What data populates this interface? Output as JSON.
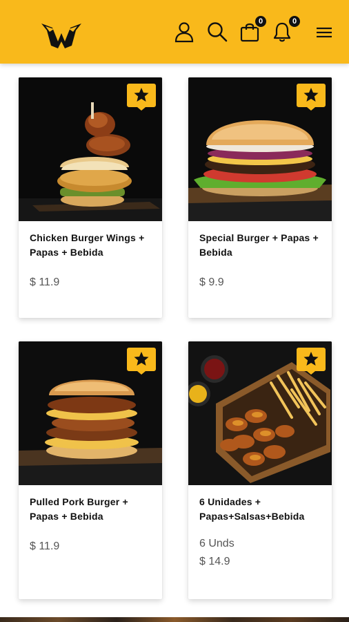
{
  "header": {
    "logo_name": "wings-logo",
    "cart_count": "0",
    "notifications_count": "0",
    "icons": [
      "user-icon",
      "search-icon",
      "bag-icon",
      "bell-icon",
      "menu-icon"
    ]
  },
  "colors": {
    "brand": "#f9b91b",
    "dark": "#111111",
    "price": "#555555"
  },
  "products": [
    {
      "title": "Chicken Burger Wings + Papas + Bebida",
      "units": "",
      "price": "$ 11.9"
    },
    {
      "title": "Special Burger + Papas + Bebida",
      "units": "",
      "price": "$ 9.9"
    },
    {
      "title": "Pulled Pork Burger + Papas + Bebida",
      "units": "",
      "price": "$ 11.9"
    },
    {
      "title": "6 Unidades + Papas+Salsas+Bebida",
      "units": "6 Unds",
      "price": "$ 14.9"
    }
  ]
}
